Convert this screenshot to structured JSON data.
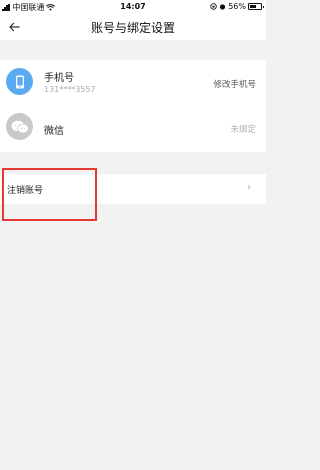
{
  "status_bar": {
    "carrier": "中国联通",
    "time": "14:07",
    "battery_percent": "56%",
    "battery_level": 0.56
  },
  "nav": {
    "back_icon": "arrow-left-icon",
    "title": "账号与绑定设置"
  },
  "accounts": [
    {
      "icon": "phone-icon",
      "icon_bg": "#5aaaf1",
      "name": "手机号",
      "sub": "131****3557",
      "action": "修改手机号",
      "action_color": "#555555"
    },
    {
      "icon": "wechat-icon",
      "icon_bg": "#c9c9c9",
      "name": "微信",
      "sub": "",
      "action": "未绑定",
      "action_color": "#b0b0b0"
    }
  ],
  "cancel_account": {
    "label": "注销账号"
  },
  "highlight_color": "#e53935"
}
